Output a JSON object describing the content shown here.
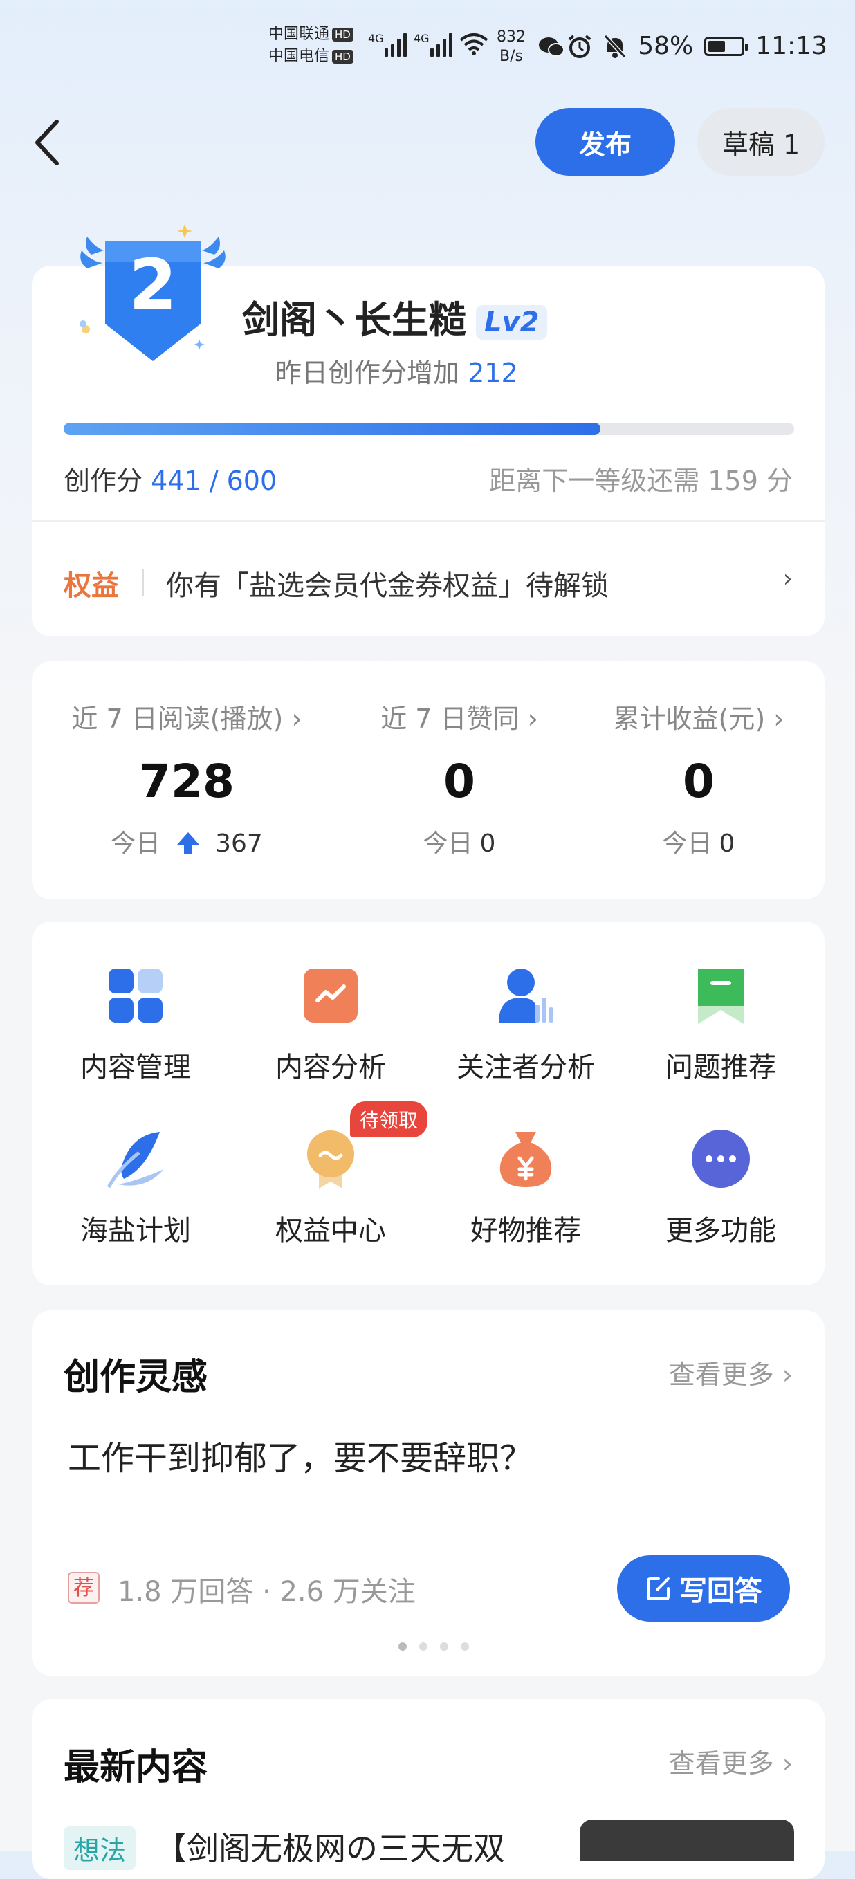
{
  "status_bar": {
    "carrier1": "中国联通",
    "carrier2": "中国电信",
    "hd": "HD",
    "net1": "4G",
    "net2": "4G",
    "speed_value": "832",
    "speed_unit": "B/s",
    "battery": "58%",
    "battery_level": 0.58,
    "time": "11:13"
  },
  "header": {
    "publish_label": "发布",
    "draft_label": "草稿 1"
  },
  "level_card": {
    "badge_number": "2",
    "username": "剑阁丶长生糙",
    "level": "Lv2",
    "yesterday_label": "昨日创作分增加",
    "yesterday_value": "212",
    "score_label": "创作分",
    "score_value": "441 / 600",
    "progress_fraction": 0.735,
    "next_level_text": "距离下一等级还需 159 分",
    "benefit_label": "权益",
    "benefit_text": "你有「盐选会员代金券权益」待解锁"
  },
  "stats": [
    {
      "label": "近 7 日阅读(播放)",
      "value": "728",
      "today_label": "今日",
      "today_value": "367"
    },
    {
      "label": "近 7 日赞同",
      "value": "0",
      "today_label": "今日",
      "today_value": "0"
    },
    {
      "label": "累计收益(元)",
      "value": "0",
      "today_label": "今日",
      "today_value": "0"
    }
  ],
  "tools": [
    {
      "label": "内容管理",
      "icon": "grid-icon"
    },
    {
      "label": "内容分析",
      "icon": "chart-icon"
    },
    {
      "label": "关注者分析",
      "icon": "follower-icon"
    },
    {
      "label": "问题推荐",
      "icon": "bookmark-icon"
    },
    {
      "label": "海盐计划",
      "icon": "feather-icon"
    },
    {
      "label": "权益中心",
      "icon": "medal-icon"
    },
    {
      "label": "好物推荐",
      "icon": "moneybag-icon"
    },
    {
      "label": "更多功能",
      "icon": "more-icon"
    }
  ],
  "tools_badge": "待领取",
  "inspiration": {
    "title": "创作灵感",
    "more": "查看更多",
    "question": "工作干到抑郁了，要不要辞职？",
    "rec_tag": "荐",
    "stats": "1.8 万回答 · 2.6 万关注",
    "answer_button": "写回答"
  },
  "latest": {
    "title": "最新内容",
    "more": "查看更多",
    "tag": "想法",
    "item_title": "【剑阁无极网の三天无双"
  },
  "colors": {
    "primary": "#2d6fe8",
    "benefit": "#e8763e",
    "badge_red": "#e8453c"
  }
}
